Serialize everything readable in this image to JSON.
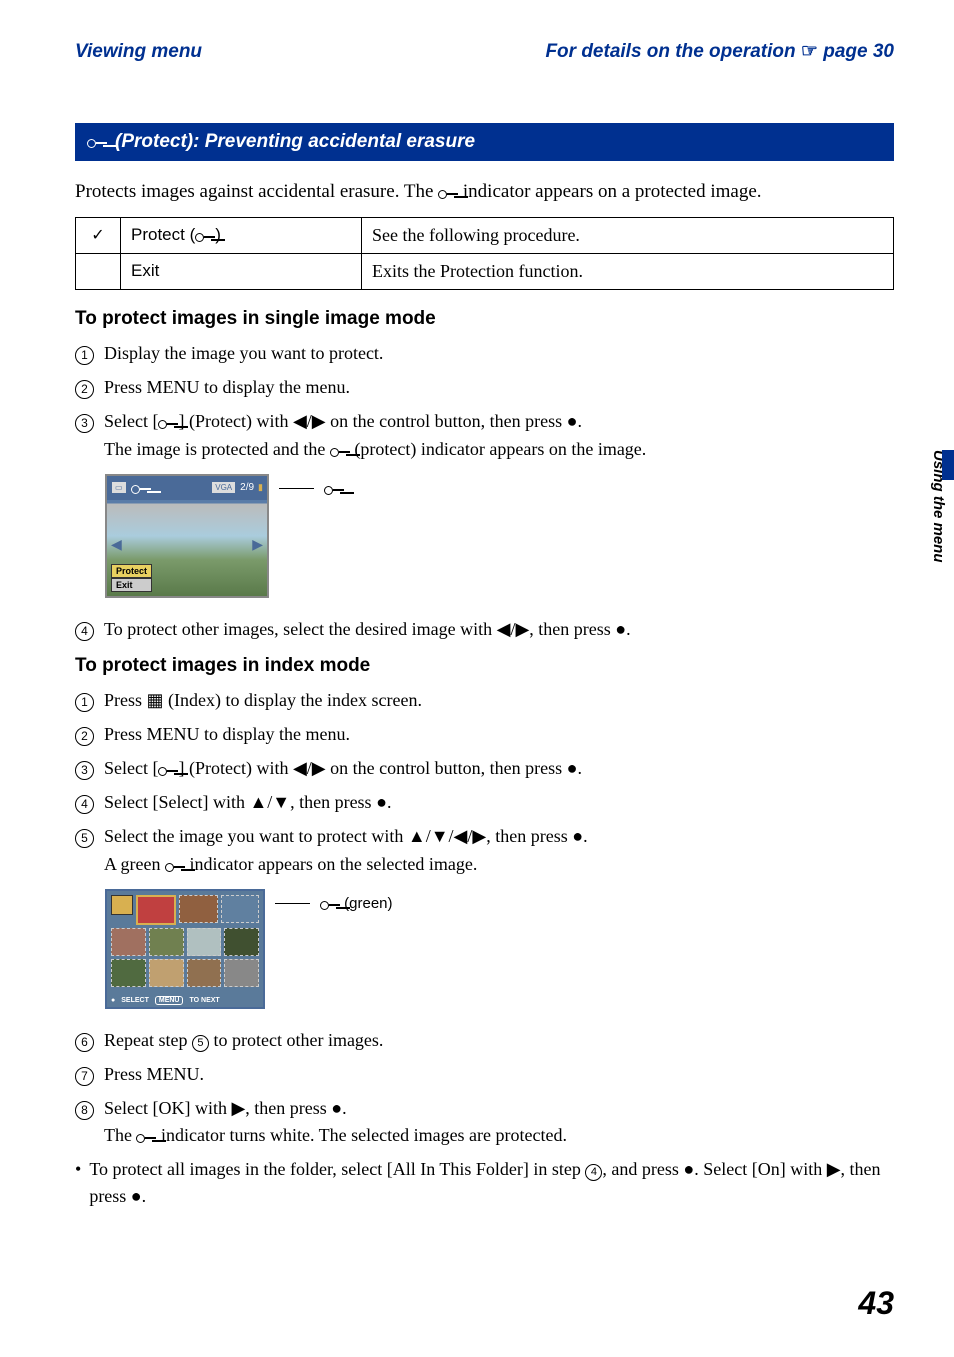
{
  "header": {
    "left": "Viewing menu",
    "right_prefix": "For details on the operation ",
    "right_page_ref": "page 30"
  },
  "section_title": "(Protect): Preventing accidental erasure",
  "intro": {
    "prefix": "Protects images against accidental erasure. The ",
    "suffix": " indicator appears on a protected image."
  },
  "table": {
    "rows": [
      {
        "check": "✓",
        "label_prefix": "Protect (",
        "label_suffix": ")",
        "desc": "See the following procedure."
      },
      {
        "check": "",
        "label": "Exit",
        "desc": "Exits the Protection function."
      }
    ]
  },
  "single_mode": {
    "heading": "To protect images in single image mode",
    "steps": {
      "s1": "Display the image you want to protect.",
      "s2": "Press MENU to display the menu.",
      "s3a": "Select [",
      "s3b": "] (Protect) with ◀/▶ on the control button, then press ●.",
      "s3c_prefix": "The image is protected and the ",
      "s3c_suffix": " (protect) indicator appears on the image.",
      "s4": "To protect other images, select the desired image with ◀/▶, then press ●."
    },
    "screenshot": {
      "badge_vga": "VGA",
      "count": "2/9",
      "menu1": "Protect",
      "menu2": "Exit"
    }
  },
  "index_mode": {
    "heading": "To protect images in index mode",
    "steps": {
      "s1a": "Press ",
      "s1b": " (Index) to display the index screen.",
      "s2": "Press MENU to display the menu.",
      "s3a": "Select [",
      "s3b": "] (Protect) with ◀/▶ on the control button, then press ●.",
      "s4": "Select [Select] with ▲/▼, then press ●.",
      "s5a": "Select the image you want to protect with ▲/▼/◀/▶, then press ●.",
      "s5b_prefix": "A green ",
      "s5b_suffix": " indicator appears on the selected image.",
      "s6a": "Repeat step ",
      "s6b": " to protect other images.",
      "s7": "Press MENU.",
      "s8a": "Select [OK] with ▶, then press ●.",
      "s8b_prefix": "The ",
      "s8b_suffix": " indicator turns white. The selected images are protected."
    },
    "callout": " (green)",
    "screenshot": {
      "select": "SELECT",
      "menu": "MENU",
      "tonext": "TO NEXT"
    },
    "bullet": {
      "prefix": "To protect all images in the folder, select [All In This Folder] in step ",
      "mid": ", and press ●. Select [On] with ▶, then press ●."
    }
  },
  "side_tab": "Using the menu",
  "page_number": "43",
  "icons": {
    "index_glyph": "▦",
    "check": "✓",
    "hand": "☞"
  }
}
